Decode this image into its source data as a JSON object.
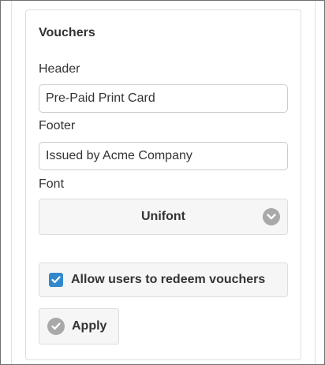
{
  "card": {
    "title": "Vouchers"
  },
  "header_field": {
    "label": "Header",
    "value": "Pre-Paid Print Card"
  },
  "footer_field": {
    "label": "Footer",
    "value": "Issued by Acme Company"
  },
  "font_field": {
    "label": "Font",
    "selected": "Unifont",
    "icon": "chevron-down-icon"
  },
  "redeem_option": {
    "label": "Allow users to redeem vouchers",
    "checked": true,
    "icon": "checkmark-icon"
  },
  "apply_button": {
    "label": "Apply",
    "icon": "check-circle-icon"
  },
  "colors": {
    "checkbox": "#3388cc",
    "icon_circle": "#a9a9a9",
    "button_bg": "#f6f6f6"
  }
}
